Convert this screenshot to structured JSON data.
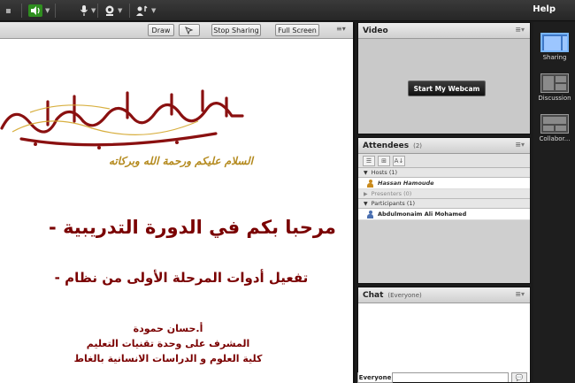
{
  "topbar": {
    "help_label": "Help"
  },
  "share_toolbar": {
    "draw_label": "Draw",
    "stop_sharing_label": "Stop Sharing",
    "full_screen_label": "Full Screen"
  },
  "slide": {
    "greeting": "السلام عليكم ورحمة الله وبركاته",
    "welcome": "مرحبا بكم في الدورة التدريبية -",
    "subtitle": "تفعيل أدوات المرحلة الأولى من نظام -",
    "presenter_name": "أ.حسان حمودة",
    "presenter_role": "المشرف على وحدة تقنيات التعليم",
    "presenter_org": "كلية العلوم و الدراسات الانسانية بالغاط"
  },
  "video_pod": {
    "title": "Video",
    "start_webcam_label": "Start My Webcam"
  },
  "attendees_pod": {
    "title": "Attendees",
    "count": "(2)",
    "groups": [
      {
        "label": "Hosts (1)"
      },
      {
        "label": "Presenters (0)"
      },
      {
        "label": "Participants (1)"
      }
    ],
    "host_name": "Hassan Hamoude",
    "participant_name": "Abdulmonaim Ali Mohamed"
  },
  "chat_pod": {
    "title": "Chat",
    "scope": "(Everyone)",
    "tab_label": "Everyone"
  },
  "layouts": {
    "items": [
      {
        "label": "Sharing"
      },
      {
        "label": "Discussion"
      },
      {
        "label": "Collabor..."
      }
    ]
  },
  "colors": {
    "slide_text": "#7a0000",
    "calligraphy": "#8a1010",
    "greeting": "#b48a1e",
    "active_layout": "#3f78c7"
  }
}
